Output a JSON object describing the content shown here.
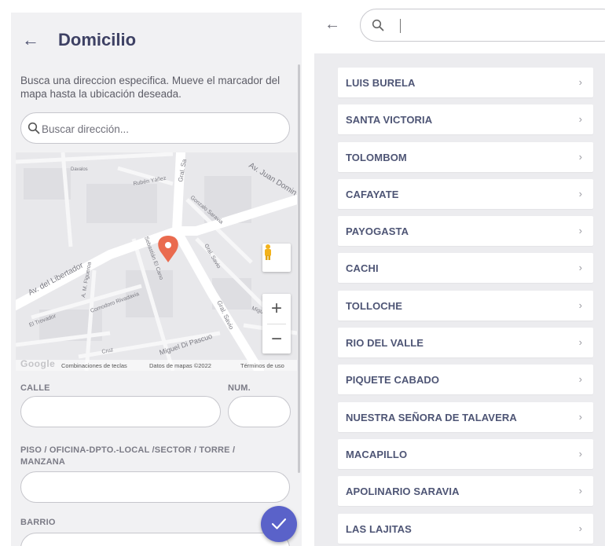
{
  "left": {
    "title": "Domicilio",
    "description": "Busca una direccion especifica. Mueve el marcador del mapa hasta la ubicación deseada.",
    "search_placeholder": "Buscar dirección...",
    "map": {
      "street_labels": [
        "Av. del Libertador",
        "Av. Juan Domin",
        "Rubén Yáñez",
        "Gral. Sa",
        "Gonzalo Saravia",
        "Sebastián El Cano",
        "Gral. Savio",
        "A. M. Figueroa",
        "El Trovador",
        "Comodoro Rivadavia",
        "Miguel Di Pascuo",
        "Gral. Savio",
        "Miguel de",
        "Davalos",
        "Cruz"
      ],
      "footer_keyboard": "Combinaciones de teclas",
      "footer_data": "Datos de mapas ©2022",
      "footer_terms": "Términos de uso",
      "google": "Google",
      "zoom_in": "+",
      "zoom_out": "−"
    },
    "fields": {
      "calle_label": "CALLE",
      "num_label": "NUM.",
      "piso_label": "PISO / OFICINA-DPTO.-LOCAL /SECTOR / TORRE / MANZANA",
      "barrio_label": "BARRIO"
    },
    "accent_color": "#5a62c9"
  },
  "right": {
    "items": [
      {
        "label": "LUIS BURELA"
      },
      {
        "label": "SANTA VICTORIA"
      },
      {
        "label": "TOLOMBOM"
      },
      {
        "label": "CAFAYATE"
      },
      {
        "label": "PAYOGASTA"
      },
      {
        "label": "CACHI"
      },
      {
        "label": "TOLLOCHE"
      },
      {
        "label": "RIO DEL VALLE"
      },
      {
        "label": "PIQUETE CABADO"
      },
      {
        "label": "NUESTRA SEÑORA DE TALAVERA"
      },
      {
        "label": "MACAPILLO"
      },
      {
        "label": "APOLINARIO SARAVIA"
      },
      {
        "label": "LAS LAJITAS"
      }
    ],
    "chevron": "›"
  },
  "icons": {
    "back": "arrow-left-icon",
    "search": "search-icon",
    "pin": "map-pin-icon",
    "pegman": "street-view-icon",
    "check": "check-icon"
  }
}
